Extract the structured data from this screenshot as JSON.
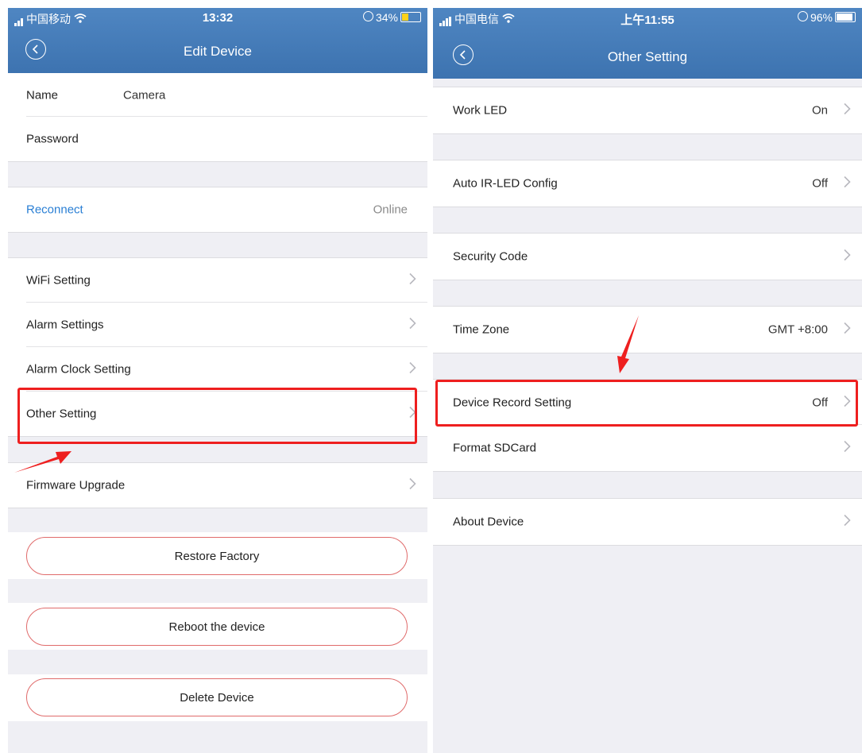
{
  "left": {
    "status": {
      "carrier": "中国移动",
      "time": "13:32",
      "battery": "34%"
    },
    "nav": {
      "title": "Edit Device"
    },
    "name_row": {
      "label": "Name",
      "value": "Camera"
    },
    "password_row": {
      "label": "Password"
    },
    "reconnect_row": {
      "label": "Reconnect",
      "status": "Online"
    },
    "menu": [
      {
        "label": "WiFi Setting"
      },
      {
        "label": "Alarm Settings"
      },
      {
        "label": "Alarm Clock Setting"
      },
      {
        "label": "Other Setting"
      }
    ],
    "firmware_row": {
      "label": "Firmware Upgrade"
    },
    "buttons": {
      "restore": "Restore Factory",
      "reboot": "Reboot the device",
      "delete": "Delete Device"
    }
  },
  "right": {
    "status": {
      "carrier": "中国电信",
      "time": "上午11:55",
      "battery": "96%"
    },
    "nav": {
      "title": "Other Setting"
    },
    "rows": [
      {
        "label": "Work LED",
        "value": "On"
      },
      {
        "label": "Auto IR-LED Config",
        "value": "Off"
      },
      {
        "label": "Security Code",
        "value": ""
      },
      {
        "label": "Time Zone",
        "value": "GMT +8:00"
      },
      {
        "label": "Device Record Setting",
        "value": "Off"
      },
      {
        "label": "Format SDCard",
        "value": ""
      },
      {
        "label": "About Device",
        "value": ""
      }
    ]
  },
  "colors": {
    "header": "#4a7fbc",
    "link": "#2a7fd4",
    "button_border": "#e06b6b",
    "highlight": "#ee1f1f",
    "background": "#efeff4"
  }
}
